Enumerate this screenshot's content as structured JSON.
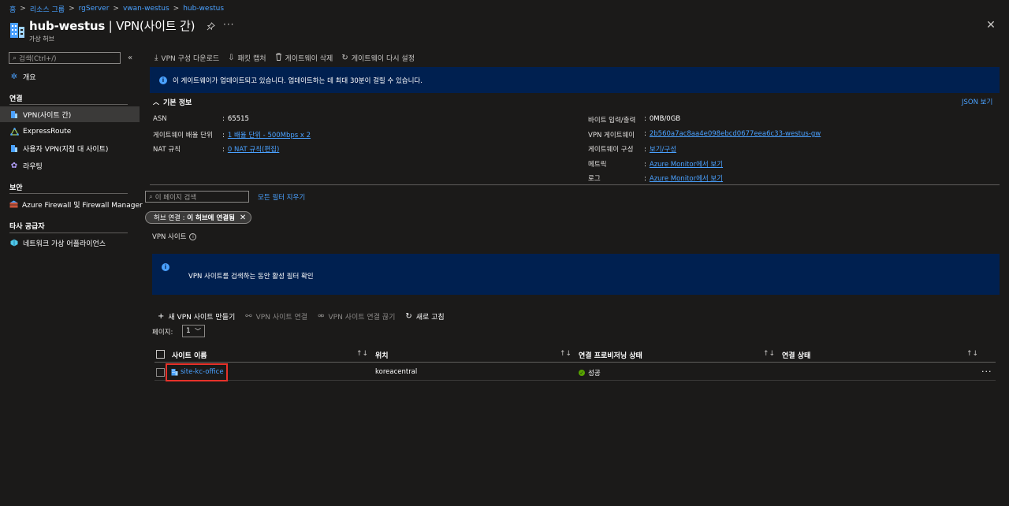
{
  "breadcrumb": {
    "items": [
      "홈",
      "리소스 그룹",
      "rgServer",
      "vwan-westus",
      "hub-westus"
    ],
    "separator": ">"
  },
  "header": {
    "resource_name": "hub-westus",
    "separator": " | ",
    "blade_title": "VPN(사이트 간)",
    "resource_type": "가상 허브",
    "more": "···",
    "close": "✕"
  },
  "sidebar": {
    "search_placeholder": "검색(Ctrl+/)",
    "collapse": "«",
    "overview": "개요",
    "groups": {
      "connectivity": "연결",
      "security": "보안",
      "third_party": "타사 공급자"
    },
    "items": {
      "vpn_s2s": "VPN(사이트 간)",
      "expressroute": "ExpressRoute",
      "user_vpn": "사용자 VPN(지점 대 사이트)",
      "routing": "라우팅",
      "firewall": "Azure Firewall 및 Firewall Manager",
      "nva": "네트워크 가상 어플라이언스"
    }
  },
  "toolbar": {
    "download_config": "VPN 구성 다운로드",
    "packet_capture": "패킷 캡처",
    "delete_gateway": "게이트웨이 삭제",
    "reset_gateway": "게이트웨이 다시 설정"
  },
  "info_banner": {
    "text": "이 게이트웨이가 업데이트되고 있습니다. 업데이트하는 데 최대 30분이 걸릴 수 있습니다."
  },
  "essentials": {
    "title": "기본 정보",
    "json_view": "JSON 보기",
    "left": [
      {
        "label": "ASN",
        "value": "65515",
        "link": false
      },
      {
        "label": "게이트웨이 배율 단위",
        "value": "1 배율 단위 - 500Mbps x 2",
        "link": true
      },
      {
        "label": "NAT 규칙",
        "value": "0 NAT 규칙(편집)",
        "link": true
      }
    ],
    "right": [
      {
        "label": "바이트 입력/출력",
        "value": "0MB/0GB",
        "link": false
      },
      {
        "label": "VPN 게이트웨이",
        "value": "2b560a7ac8aa4e098ebcd0677eea6c33-westus-gw",
        "link": true
      },
      {
        "label": "게이트웨이 구성",
        "value": "보기/구성",
        "link": true
      },
      {
        "label": "메트릭",
        "value": "Azure Monitor에서 보기",
        "link": true
      },
      {
        "label": "로그",
        "value": "Azure Monitor에서 보기",
        "link": true
      }
    ]
  },
  "filters": {
    "search_placeholder": "이 페이지 검색",
    "clear_all": "모든 필터 지우기",
    "pill_key": "허브 연결 : ",
    "pill_value": "이 허브에 연결됨"
  },
  "vpn_sites": {
    "label": "VPN 사이트",
    "banner_text": "VPN 사이트를 검색하는 동안 활성 필터 확인"
  },
  "list_commands": {
    "create": "새 VPN 사이트 만들기",
    "connect": "VPN 사이트 연결",
    "disconnect": "VPN 사이트 연결 끊기",
    "refresh": "새로 고침"
  },
  "pagination": {
    "label": "페이지:",
    "current": "1"
  },
  "table": {
    "columns": [
      "사이트 이름",
      "위치",
      "연결 프로비저닝 상태",
      "연결 상태"
    ],
    "rows": [
      {
        "site_name": "site-kc-office",
        "location": "koreacentral",
        "provisioning": "성공",
        "connection": ""
      }
    ]
  },
  "colors": {
    "accent": "#4aa1ff",
    "banner": "#002050",
    "success": "#57a300",
    "highlight": "#e8322a"
  }
}
